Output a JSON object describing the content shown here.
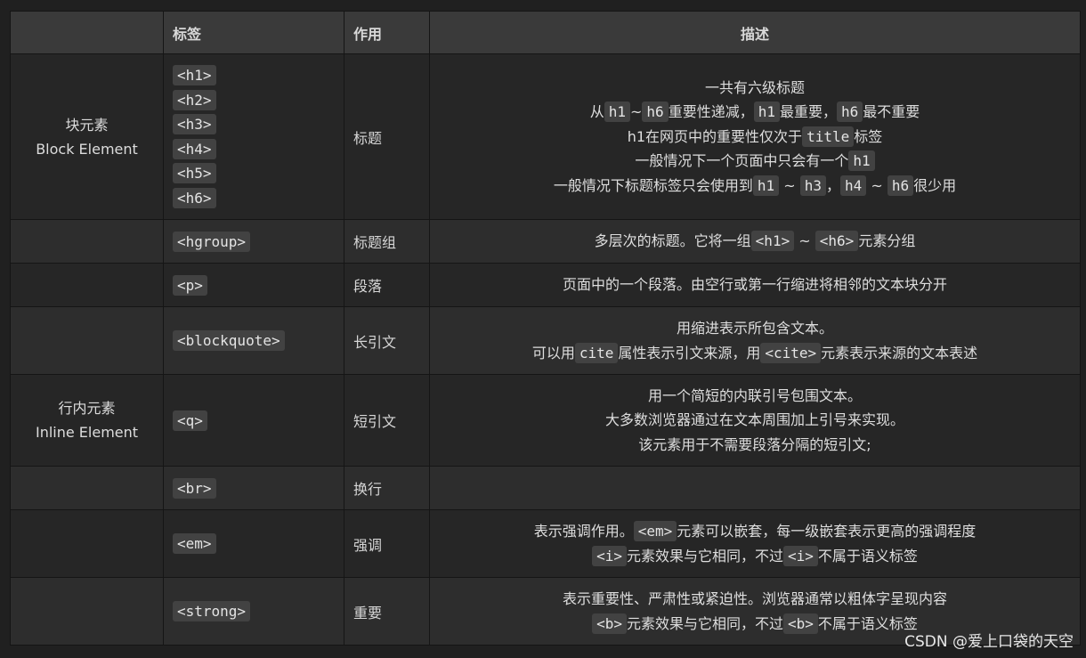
{
  "header": {
    "col1": "",
    "col2": "标签",
    "col3": "作用",
    "col4": "描述"
  },
  "categories": {
    "block": {
      "zh": "块元素",
      "en": "Block Element"
    },
    "inline": {
      "zh": "行内元素",
      "en": "Inline Element"
    }
  },
  "rows": {
    "h": {
      "tags": [
        "<h1>",
        "<h2>",
        "<h3>",
        "<h4>",
        "<h5>",
        "<h6>"
      ],
      "func": "标题",
      "l1": "一共有六级标题",
      "l2": {
        "c1": "从",
        "code1": "h1",
        "c2": "~",
        "code2": "h6",
        "c3": "重要性递减，",
        "code3": "h1",
        "c4": "最重要，",
        "code4": "h6",
        "c5": "最不重要"
      },
      "l3": {
        "c1": "h1在网页中的重要性仅次于",
        "code1": "title",
        "c2": "标签"
      },
      "l4": {
        "c1": "一般情况下一个页面中只会有一个",
        "code1": "h1"
      },
      "l5": {
        "c1": "一般情况下标题标签只会使用到",
        "code1": "h1",
        "c2": " ~ ",
        "code2": "h3",
        "c3": "，",
        "code3": "h4",
        "c4": " ~ ",
        "code4": "h6",
        "c5": "很少用"
      }
    },
    "hgroup": {
      "tag": "<hgroup>",
      "func": "标题组",
      "d": {
        "c1": "多层次的标题。它将一组",
        "code1": "<h1>",
        "c2": " ~ ",
        "code2": "<h6>",
        "c3": "元素分组"
      }
    },
    "p": {
      "tag": "<p>",
      "func": "段落",
      "desc": "页面中的一个段落。由空行或第一行缩进将相邻的文本块分开"
    },
    "blockquote": {
      "tag": "<blockquote>",
      "func": "长引文",
      "l1": "用缩进表示所包含文本。",
      "l2": {
        "c1": "可以用",
        "code1": "cite",
        "c2": "属性表示引文来源，用",
        "code2": "<cite>",
        "c3": "元素表示来源的文本表述"
      }
    },
    "q": {
      "tag": "<q>",
      "func": "短引文",
      "l1": "用一个简短的内联引号包围文本。",
      "l2": "大多数浏览器通过在文本周围加上引号来实现。",
      "l3": "该元素用于不需要段落分隔的短引文;"
    },
    "br": {
      "tag": "<br>",
      "func": "换行",
      "desc": ""
    },
    "em": {
      "tag": "<em>",
      "func": "强调",
      "l1": {
        "c1": "表示强调作用。",
        "code1": "<em>",
        "c2": "元素可以嵌套，每一级嵌套表示更高的强调程度"
      },
      "l2": {
        "code1": "<i>",
        "c1": "元素效果与它相同，不过",
        "code2": "<i>",
        "c2": "不属于语义标签"
      }
    },
    "strong": {
      "tag": "<strong>",
      "func": "重要",
      "l1": "表示重要性、严肃性或紧迫性。浏览器通常以粗体字呈现内容",
      "l2": {
        "code1": "<b>",
        "c1": "元素效果与它相同，不过",
        "code2": "<b>",
        "c2": "不属于语义标签"
      }
    }
  },
  "watermark": "CSDN @爱上口袋的天空"
}
